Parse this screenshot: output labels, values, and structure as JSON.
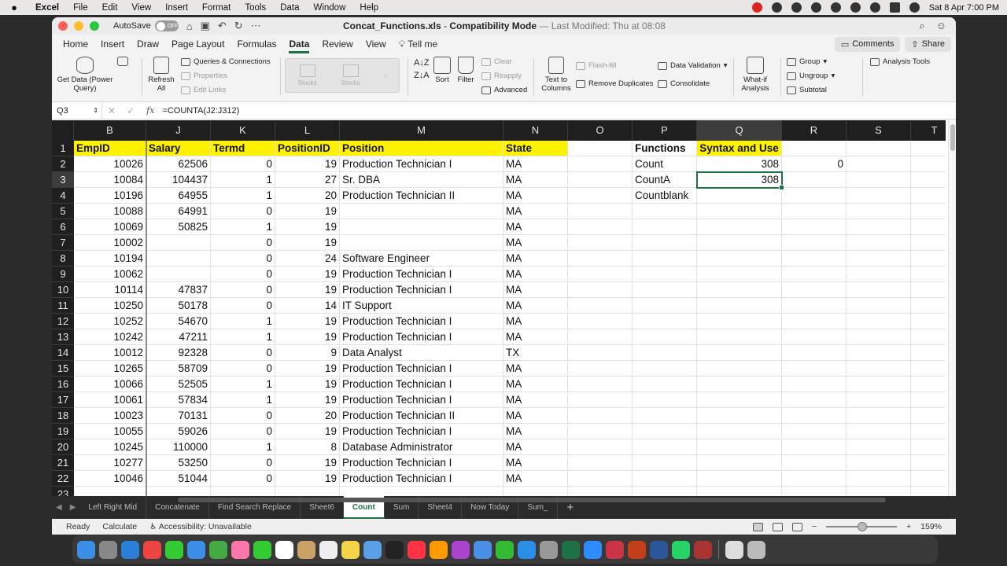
{
  "menubar": {
    "apple": "",
    "app": "Excel",
    "items": [
      "File",
      "Edit",
      "View",
      "Insert",
      "Format",
      "Tools",
      "Data",
      "Window",
      "Help"
    ],
    "datetime": "Sat 8 Apr  7:00 PM"
  },
  "window": {
    "autosave_label": "AutoSave",
    "autosave_state": "OFF",
    "title_file": "Concat_Functions.xls",
    "title_mode": "Compatibility Mode",
    "title_modified": "— Last Modified: Thu at 08:08"
  },
  "ribbon_tabs": {
    "items": [
      "Home",
      "Insert",
      "Draw",
      "Page Layout",
      "Formulas",
      "Data",
      "Review",
      "View"
    ],
    "active": "Data",
    "tellme": "Tell me",
    "comments": "Comments",
    "share": "Share"
  },
  "ribbon": {
    "get_data": "Get Data (Power Query)",
    "refresh_all": "Refresh All",
    "queries": "Queries & Connections",
    "properties": "Properties",
    "edit_links": "Edit Links",
    "stocks1": "Stocks",
    "stocks2": "Stocks",
    "sort": "Sort",
    "filter": "Filter",
    "clear": "Clear",
    "reapply": "Reapply",
    "advanced": "Advanced",
    "text_to_columns": "Text to Columns",
    "flash_fill": "Flash-fill",
    "remove_duplicates": "Remove Duplicates",
    "data_validation": "Data Validation",
    "consolidate": "Consolidate",
    "whatif": "What-if Analysis",
    "group": "Group",
    "ungroup": "Ungroup",
    "subtotal": "Subtotal",
    "analysis_tools": "Analysis Tools"
  },
  "formula_bar": {
    "name_box": "Q3",
    "fx": "fx",
    "formula": "=COUNTA(J2:J312)"
  },
  "grid": {
    "columns": [
      "B",
      "J",
      "K",
      "L",
      "M",
      "N",
      "O",
      "P",
      "Q",
      "R",
      "S",
      "T"
    ],
    "selected_column": "Q",
    "selected_row": "3",
    "row_numbers": [
      "1",
      "2",
      "3",
      "4",
      "5",
      "6",
      "7",
      "8",
      "9",
      "10",
      "11",
      "12",
      "13",
      "14",
      "15",
      "16",
      "17",
      "18",
      "19",
      "20",
      "21",
      "22",
      "23"
    ],
    "headers": [
      "EmpID",
      "Salary",
      "Termd",
      "PositionID",
      "Position",
      "State"
    ],
    "rows": [
      [
        "10026",
        "62506",
        "0",
        "19",
        "Production Technician I",
        "MA"
      ],
      [
        "10084",
        "104437",
        "1",
        "27",
        "Sr. DBA",
        "MA"
      ],
      [
        "10196",
        "64955",
        "1",
        "20",
        "Production Technician II",
        "MA"
      ],
      [
        "10088",
        "64991",
        "0",
        "19",
        "",
        "MA"
      ],
      [
        "10069",
        "50825",
        "1",
        "19",
        "",
        "MA"
      ],
      [
        "10002",
        "",
        "0",
        "19",
        "",
        "MA"
      ],
      [
        "10194",
        "",
        "0",
        "24",
        "Software Engineer",
        "MA"
      ],
      [
        "10062",
        "",
        "0",
        "19",
        "Production Technician I",
        "MA"
      ],
      [
        "10114",
        "47837",
        "0",
        "19",
        "Production Technician I",
        "MA"
      ],
      [
        "10250",
        "50178",
        "0",
        "14",
        "IT Support",
        "MA"
      ],
      [
        "10252",
        "54670",
        "1",
        "19",
        "Production Technician I",
        "MA"
      ],
      [
        "10242",
        "47211",
        "1",
        "19",
        "Production Technician I",
        "MA"
      ],
      [
        "10012",
        "92328",
        "0",
        "9",
        "Data Analyst",
        "TX"
      ],
      [
        "10265",
        "58709",
        "0",
        "19",
        "Production Technician I",
        "MA"
      ],
      [
        "10066",
        "52505",
        "1",
        "19",
        "Production Technician I",
        "MA"
      ],
      [
        "10061",
        "57834",
        "1",
        "19",
        "Production Technician I",
        "MA"
      ],
      [
        "10023",
        "70131",
        "0",
        "20",
        "Production Technician II",
        "MA"
      ],
      [
        "10055",
        "59026",
        "0",
        "19",
        "Production Technician I",
        "MA"
      ],
      [
        "10245",
        "110000",
        "1",
        "8",
        "Database Administrator",
        "MA"
      ],
      [
        "10277",
        "53250",
        "0",
        "19",
        "Production Technician I",
        "MA"
      ],
      [
        "10046",
        "51044",
        "0",
        "19",
        "Production Technician I",
        "MA"
      ]
    ],
    "functions_header": "Functions",
    "syntax_header": "Syntax and Use",
    "functions": [
      {
        "name": "Count",
        "value": "308",
        "extra": "0"
      },
      {
        "name": "CountA",
        "value": "308",
        "extra": ""
      },
      {
        "name": "Countblank",
        "value": "",
        "extra": ""
      }
    ]
  },
  "sheets": {
    "tabs": [
      "Left Right Mid",
      "Concatenate",
      "Find Search Replace",
      "Sheet6",
      "Count",
      "Sum",
      "Sheet4",
      "Now Today",
      "Sum_"
    ],
    "active": "Count",
    "add": "+"
  },
  "status": {
    "ready": "Ready",
    "calculate": "Calculate",
    "accessibility": "Accessibility: Unavailable",
    "zoom": "159%"
  },
  "dock_apps": [
    "finder-icon",
    "launchpad-icon",
    "safari-icon",
    "chrome-icon",
    "messages-icon",
    "mail-icon",
    "maps-icon",
    "photos-icon",
    "facetime-icon",
    "calendar-icon",
    "finder2-icon",
    "reminders-icon",
    "notes-icon",
    "preview-icon",
    "tv-icon",
    "music-icon",
    "pages-icon",
    "podcasts-icon",
    "keynote-icon",
    "numbers-icon",
    "appstore-icon",
    "settings-icon",
    "excel-icon",
    "zoom-icon",
    "shortcuts-icon",
    "powerpoint-icon",
    "word-icon",
    "whatsapp-icon",
    "dictionary-icon",
    "file-icon",
    "trash-icon"
  ]
}
